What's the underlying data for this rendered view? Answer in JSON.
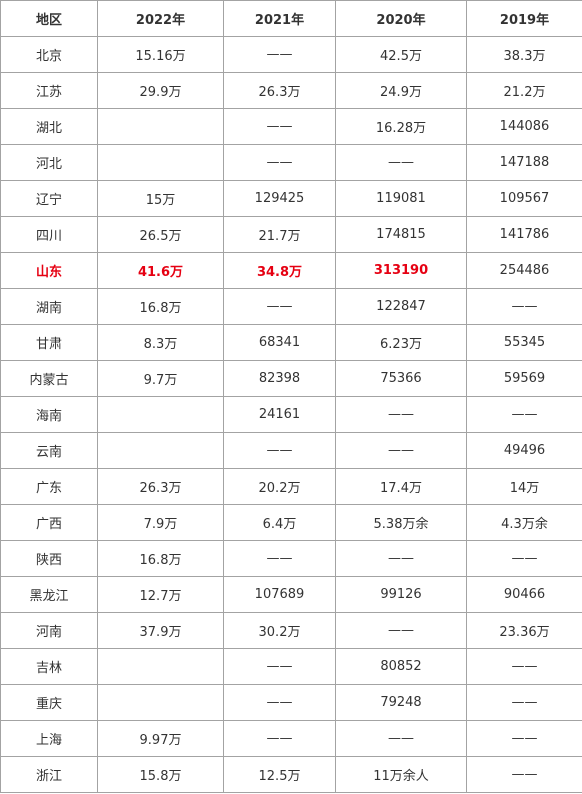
{
  "table": {
    "headers": [
      "地区",
      "2022年",
      "2021年",
      "2020年",
      "2019年"
    ],
    "highlight_color": "#e60012",
    "rows": [
      {
        "region": "北京",
        "y2022": "15.16万",
        "y2021": "——",
        "y2020": "42.5万",
        "y2019": "38.3万"
      },
      {
        "region": "江苏",
        "y2022": "29.9万",
        "y2021": "26.3万",
        "y2020": "24.9万",
        "y2019": "21.2万"
      },
      {
        "region": "湖北",
        "y2022": "",
        "y2021": "——",
        "y2020": "16.28万",
        "y2019": "144086"
      },
      {
        "region": "河北",
        "y2022": "",
        "y2021": "——",
        "y2020": "——",
        "y2019": "147188"
      },
      {
        "region": "辽宁",
        "y2022": "15万",
        "y2021": "129425",
        "y2020": "119081",
        "y2019": "109567"
      },
      {
        "region": "四川",
        "y2022": "26.5万",
        "y2021": "21.7万",
        "y2020": "174815",
        "y2019": "141786"
      },
      {
        "region": "山东",
        "y2022": "41.6万",
        "y2021": "34.8万",
        "y2020": "313190",
        "y2019": "254486",
        "highlight": true
      },
      {
        "region": "湖南",
        "y2022": "16.8万",
        "y2021": "——",
        "y2020": "122847",
        "y2019": "——"
      },
      {
        "region": "甘肃",
        "y2022": "8.3万",
        "y2021": "68341",
        "y2020": "6.23万",
        "y2019": "55345"
      },
      {
        "region": "内蒙古",
        "y2022": "9.7万",
        "y2021": "82398",
        "y2020": "75366",
        "y2019": "59569"
      },
      {
        "region": "海南",
        "y2022": "",
        "y2021": "24161",
        "y2020": "——",
        "y2019": "——"
      },
      {
        "region": "云南",
        "y2022": "",
        "y2021": "——",
        "y2020": "——",
        "y2019": "49496"
      },
      {
        "region": "广东",
        "y2022": "26.3万",
        "y2021": "20.2万",
        "y2020": "17.4万",
        "y2019": "14万"
      },
      {
        "region": "广西",
        "y2022": "7.9万",
        "y2021": "6.4万",
        "y2020": "5.38万余",
        "y2019": "4.3万余"
      },
      {
        "region": "陕西",
        "y2022": "16.8万",
        "y2021": "——",
        "y2020": "——",
        "y2019": "——"
      },
      {
        "region": "黑龙江",
        "y2022": "12.7万",
        "y2021": "107689",
        "y2020": "99126",
        "y2019": "90466"
      },
      {
        "region": "河南",
        "y2022": "37.9万",
        "y2021": "30.2万",
        "y2020": "——",
        "y2019": "23.36万"
      },
      {
        "region": "吉林",
        "y2022": "",
        "y2021": "——",
        "y2020": "80852",
        "y2019": "——"
      },
      {
        "region": "重庆",
        "y2022": "",
        "y2021": "——",
        "y2020": "79248",
        "y2019": "——"
      },
      {
        "region": "上海",
        "y2022": "9.97万",
        "y2021": "——",
        "y2020": "——",
        "y2019": "——"
      },
      {
        "region": "浙江",
        "y2022": "15.8万",
        "y2021": "12.5万",
        "y2020": "11万余人",
        "y2019": "——"
      }
    ]
  }
}
